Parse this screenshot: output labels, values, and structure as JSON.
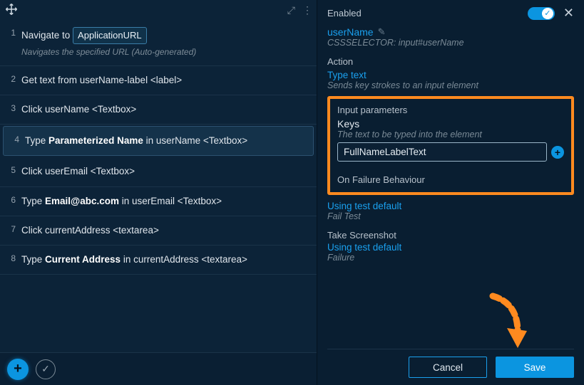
{
  "steps": [
    {
      "num": "1",
      "prefix": "Navigate to",
      "pill": "ApplicationURL",
      "sub": "Navigates the specified URL (Auto-generated)"
    },
    {
      "num": "2",
      "text_html": "Get text from userName-label <label>"
    },
    {
      "num": "3",
      "text_html": "Click userName <Textbox>"
    },
    {
      "num": "4",
      "text_html": "Type <b>Parameterized Name</b> in userName <Textbox>",
      "selected": true
    },
    {
      "num": "5",
      "text_html": "Click userEmail <Textbox>"
    },
    {
      "num": "6",
      "text_html": "Type <b>Email@abc.com</b> in userEmail <Textbox>"
    },
    {
      "num": "7",
      "text_html": "Click currentAddress <textarea>"
    },
    {
      "num": "8",
      "text_html": "Type <b>Current Address</b> in currentAddress <textarea>"
    }
  ],
  "right": {
    "enabled_label": "Enabled",
    "element_name": "userName",
    "selector": "CSSSELECTOR: input#userName",
    "action_label": "Action",
    "action_name": "Type text",
    "action_desc": "Sends key strokes to an input element",
    "input_params_label": "Input parameters",
    "keys_label": "Keys",
    "keys_hint": "The text to be typed into the element",
    "keys_value": "FullNameLabelText",
    "failure_label": "On Failure Behaviour",
    "failure_link": "Using test default",
    "failure_sub": "Fail Test",
    "screenshot_label": "Take Screenshot",
    "screenshot_link": "Using test default",
    "screenshot_sub": "Failure",
    "cancel": "Cancel",
    "save": "Save"
  }
}
